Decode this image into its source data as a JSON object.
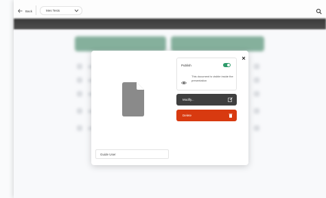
{
  "topbar": {
    "back_label": "Back",
    "dropdown_value": "Mes Tests"
  },
  "modal": {
    "publish_label": "Publish",
    "publish_on": true,
    "visibility_text": "This document is visible inside the presentation",
    "modify_label": "Modify...",
    "delete_label": "Delete",
    "username": "Guide User"
  },
  "colors": {
    "accent_green": "#2e9b6b",
    "delete_red": "#d83a10",
    "modify_dark": "#3f3f3f"
  },
  "icons": {
    "back": "arrow-left-icon",
    "dropdown": "chevron-down-icon",
    "search": "search-icon",
    "close": "close-icon",
    "file": "file-icon",
    "visibility": "eye-icon",
    "modify": "edit-icon",
    "delete": "trash-icon"
  }
}
